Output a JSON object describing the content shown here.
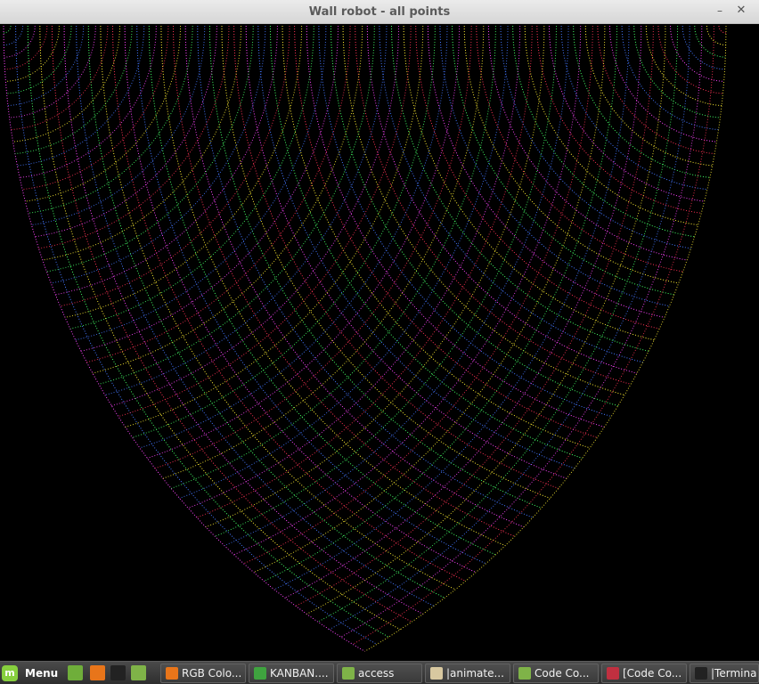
{
  "window": {
    "title": "Wall robot - all points",
    "minimize_glyph": "–",
    "close_glyph": "✕"
  },
  "plot": {
    "description_colors": [
      "#ff3355",
      "#ffee33",
      "#44ff66",
      "#4477ff",
      "#ff44ff"
    ],
    "background": "#000000"
  },
  "panel": {
    "menu_label": "Menu",
    "menu_icon": "linux-mint-logo-icon",
    "launchers": [
      {
        "icon": "show-desktop-icon",
        "color": "#6fae3a"
      },
      {
        "icon": "firefox-icon",
        "color": "#e8751a"
      },
      {
        "icon": "terminal-icon",
        "color": "#222222"
      },
      {
        "icon": "folder-icon",
        "color": "#7fb348"
      }
    ],
    "tasks": [
      {
        "label": "RGB Colo...",
        "icon": "firefox-icon",
        "color": "#e8751a"
      },
      {
        "label": "KANBAN....",
        "icon": "spreadsheet-icon",
        "color": "#3fa33f"
      },
      {
        "label": "access",
        "icon": "folder-icon",
        "color": "#7fb348"
      },
      {
        "label": "|animate...",
        "icon": "text-editor-icon",
        "color": "#d8c8a0"
      },
      {
        "label": "Code Co...",
        "icon": "folder-icon",
        "color": "#7fb348"
      },
      {
        "label": "[Code Co...",
        "icon": "eclipse-icon",
        "color": "#c03040"
      },
      {
        "label": "|Termina",
        "icon": "terminal-icon",
        "color": "#222222"
      }
    ]
  }
}
